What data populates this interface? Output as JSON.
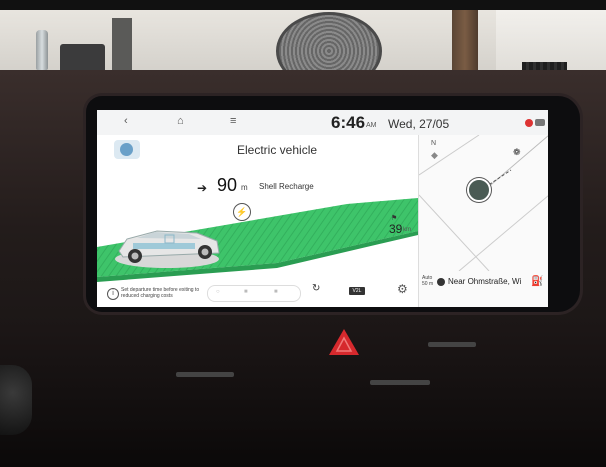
{
  "status_bar": {
    "back_icon": "back-arrow-icon",
    "home_icon": "home-icon",
    "menu_icon": "menu-icon",
    "time": "6:46",
    "ampm": "AM",
    "date": "Wed, 27/05"
  },
  "main": {
    "title": "Electric vehicle",
    "car_button_icon": "car-icon",
    "next_turn": {
      "direction_icon": "right-arrow-icon",
      "distance": "90",
      "distance_unit": "m",
      "poi_name": "Shell Recharge"
    },
    "speed_limit_icon": "speed-icon",
    "speed": "39",
    "speed_unit": "km",
    "info_text": "Set departure time before exiting to reduced charging costs",
    "pill_segments": [
      "○",
      "■",
      "■"
    ],
    "v2l_label": "V2L"
  },
  "map": {
    "north_label": "N",
    "auto_label": "Auto\n50 m",
    "location": "Near Ohmstraße, Wi"
  },
  "colors": {
    "road_green": "#3ec46a",
    "accent_red": "#d6292d",
    "screen_bg": "#f3f4f5"
  }
}
